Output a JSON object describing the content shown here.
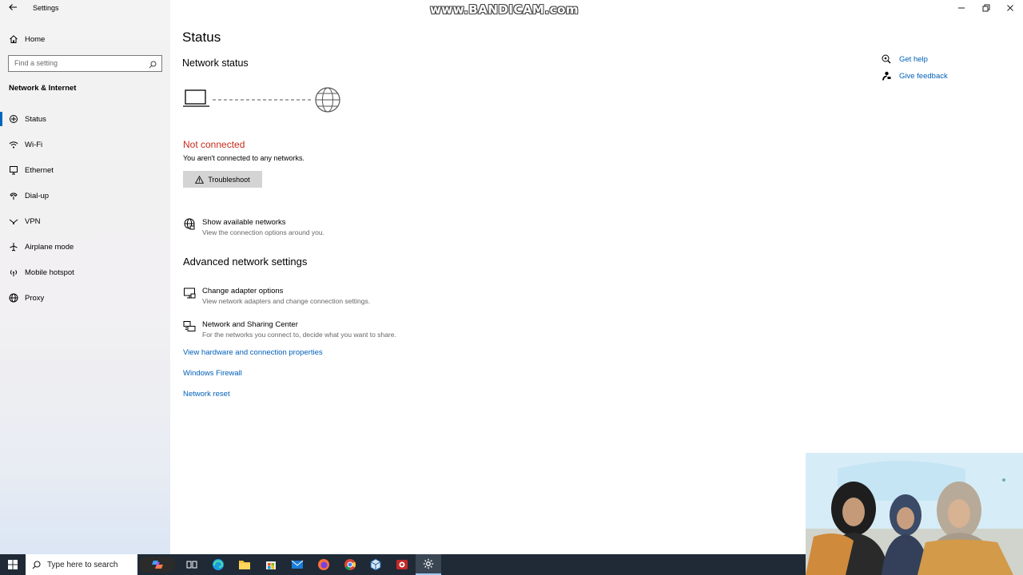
{
  "window": {
    "app_title": "Settings",
    "controls": {
      "minimize": "—",
      "restore": "❐",
      "close": "✕"
    }
  },
  "watermark": "www.BANDICAM.com",
  "sidebar": {
    "home_label": "Home",
    "search_placeholder": "Find a setting",
    "section_title": "Network & Internet",
    "items": [
      {
        "label": "Status",
        "icon": "status-icon",
        "active": true
      },
      {
        "label": "Wi-Fi",
        "icon": "wifi-icon",
        "active": false
      },
      {
        "label": "Ethernet",
        "icon": "ethernet-icon",
        "active": false
      },
      {
        "label": "Dial-up",
        "icon": "dialup-icon",
        "active": false
      },
      {
        "label": "VPN",
        "icon": "vpn-icon",
        "active": false
      },
      {
        "label": "Airplane mode",
        "icon": "airplane-icon",
        "active": false
      },
      {
        "label": "Mobile hotspot",
        "icon": "hotspot-icon",
        "active": false
      },
      {
        "label": "Proxy",
        "icon": "globe-icon",
        "active": false
      }
    ]
  },
  "main": {
    "page_title": "Status",
    "network_status_heading": "Network status",
    "connection_state": "Not connected",
    "connection_desc": "You aren't connected to any networks.",
    "troubleshoot_label": "Troubleshoot",
    "show_networks": {
      "title": "Show available networks",
      "desc": "View the connection options around you."
    },
    "advanced_heading": "Advanced network settings",
    "change_adapter": {
      "title": "Change adapter options",
      "desc": "View network adapters and change connection settings."
    },
    "sharing_center": {
      "title": "Network and Sharing Center",
      "desc": "For the networks you connect to, decide what you want to share."
    },
    "links": {
      "hardware_props": "View hardware and connection properties",
      "firewall": "Windows Firewall",
      "reset": "Network reset"
    },
    "status_color": "#c42b1c",
    "link_color": "#005fb8"
  },
  "help": {
    "get_help": "Get help",
    "give_feedback": "Give feedback"
  },
  "taskbar": {
    "search_placeholder": "Type here to search",
    "pinned_icons": [
      "task-view-icon",
      "edge-icon",
      "file-explorer-icon",
      "store-icon",
      "mail-icon",
      "firefox-icon",
      "chrome-icon",
      "virtualbox-icon",
      "app-icon",
      "settings-icon"
    ],
    "background": "#1f2a36"
  }
}
